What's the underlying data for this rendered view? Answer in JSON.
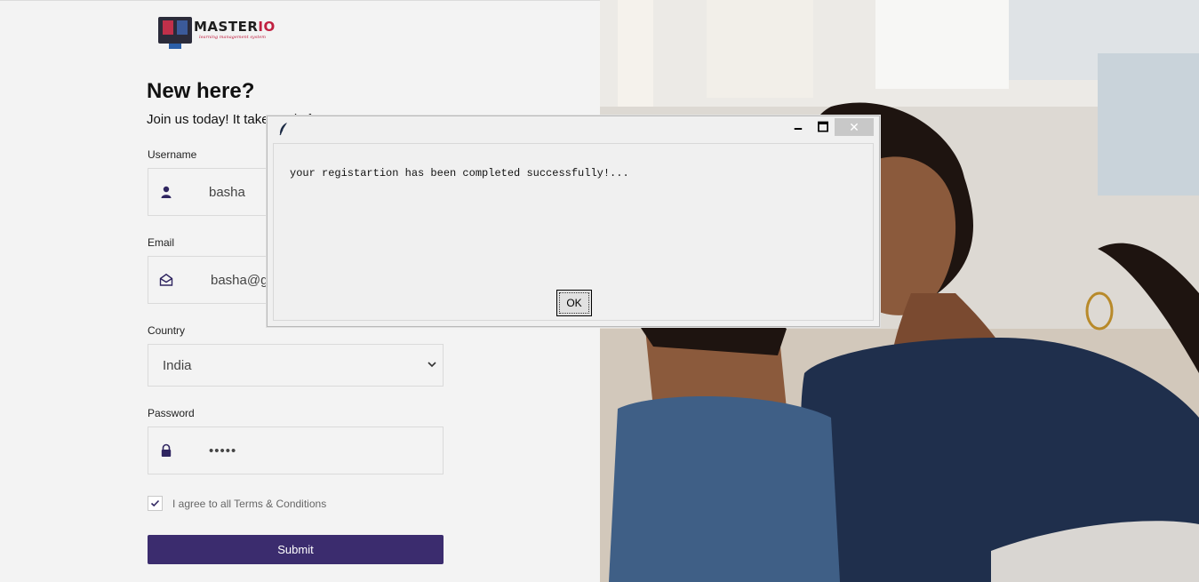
{
  "logo": {
    "brand_main": "MASTER",
    "brand_accent": "IO",
    "tagline": "learning management system"
  },
  "form": {
    "title": "New here?",
    "subtitle": "Join us today! It takes only few steps",
    "username": {
      "label": "Username",
      "value": "basha"
    },
    "email": {
      "label": "Email",
      "value": "basha@gmail.com"
    },
    "country": {
      "label": "Country",
      "selected": "India"
    },
    "password": {
      "label": "Password",
      "masked_value": "•••••"
    },
    "agree": {
      "label": "I agree to all Terms & Conditions",
      "checked": true
    },
    "submit_label": "Submit"
  },
  "dialog": {
    "title": "",
    "message": "your registartion has been completed successfully!...",
    "ok_label": "OK",
    "minimize_glyph": "🗕",
    "maximize_glyph": "🗖",
    "close_glyph": "✕"
  },
  "colors": {
    "accent": "#3b2c6e",
    "background": "#f3f3f3"
  }
}
